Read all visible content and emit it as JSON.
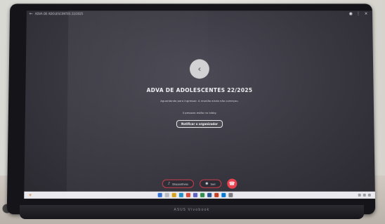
{
  "window": {
    "title": "ADVA DE ADOLESCENTES 22/2025",
    "back_icon": "arrow-left-icon"
  },
  "meeting": {
    "avatar_icon": "arrow-left-icon",
    "title": "ADVA DE ADOLESCENTES 22/2025",
    "description": "Aguardando para ingressar. A reunião ainda não começou.",
    "note": "4 pessoas estão no lobby.",
    "notify_button": "Notificar o organizador"
  },
  "controls": {
    "devices_label": "Dispositivos",
    "leave_label": "Sair",
    "end_icon": "phone-hangup-icon"
  },
  "laptop": {
    "brand": "ASUS Vivobook"
  },
  "colors": {
    "screen_bg": "#38363f",
    "accent_red": "#e8424f"
  }
}
